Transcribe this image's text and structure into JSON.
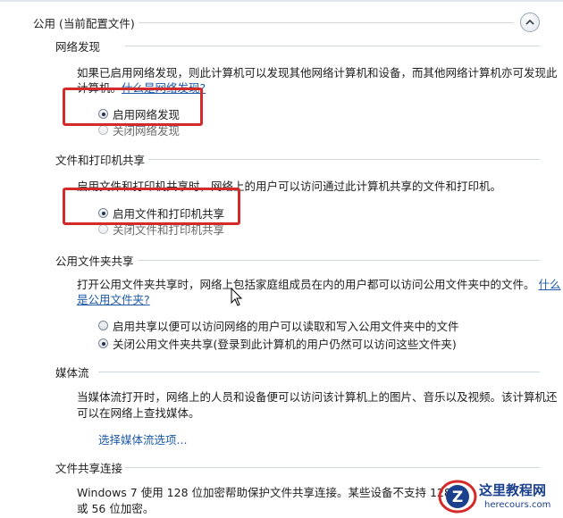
{
  "header": {
    "title": "公用 (当前配置文件)",
    "collapse_icon": "chevron-up-icon"
  },
  "network_discovery": {
    "title": "网络发现",
    "description": "如果已启用网络发现，则此计算机可以发现其他网络计算机和设备，而其他网络计算机亦可发现此计算机。",
    "description_line2_prefix": "计算机。",
    "link": "什么是网络发现?",
    "options": [
      {
        "label": "启用网络发现",
        "selected": true
      },
      {
        "label": "关闭网络发现",
        "selected": false
      }
    ]
  },
  "file_printer_sharing": {
    "title": "文件和打印机共享",
    "description": "启用文件和打印机共享时，网络上的用户可以访问通过此计算机共享的文件和打印机。",
    "options": [
      {
        "label": "启用文件和打印机共享",
        "selected": true
      },
      {
        "label": "关闭文件和打印机共享",
        "selected": false
      }
    ]
  },
  "public_folder_sharing": {
    "title": "公用文件夹共享",
    "description": "打开公用文件夹共享时，网络上包括家庭组成员在内的用户都可以访问公用文件夹中的文件。",
    "link_part1": "什么",
    "link_part2": "是公用文件夹?",
    "options": [
      {
        "label": "启用共享以便可以访问网络的用户可以读取和写入公用文件夹中的文件",
        "selected": false
      },
      {
        "label": "关闭公用文件夹共享(登录到此计算机的用户仍然可以访问这些文件夹)",
        "selected": true
      }
    ]
  },
  "media_streaming": {
    "title": "媒体流",
    "description_line1": "当媒体流打开时，网络上的人员和设备便可以访问该计算机上的图片、音乐以及视频。该计算机还",
    "description_line2": "可以在网络上查找媒体。",
    "link": "选择媒体流选项..."
  },
  "file_sharing_connection": {
    "title": "文件共享连接",
    "description_line1": "Windows 7 使用 128 位加密帮助保护文件共享连接。某些设备不支持 128 位",
    "description_line2": "或 56 位加密。"
  },
  "watermark": {
    "title": "这里教程网",
    "url": "herecours.com",
    "logo_letter": "Z"
  },
  "colors": {
    "highlight": "#d52a2a",
    "link": "#1e5aa8",
    "accent": "#1a3f8c"
  }
}
